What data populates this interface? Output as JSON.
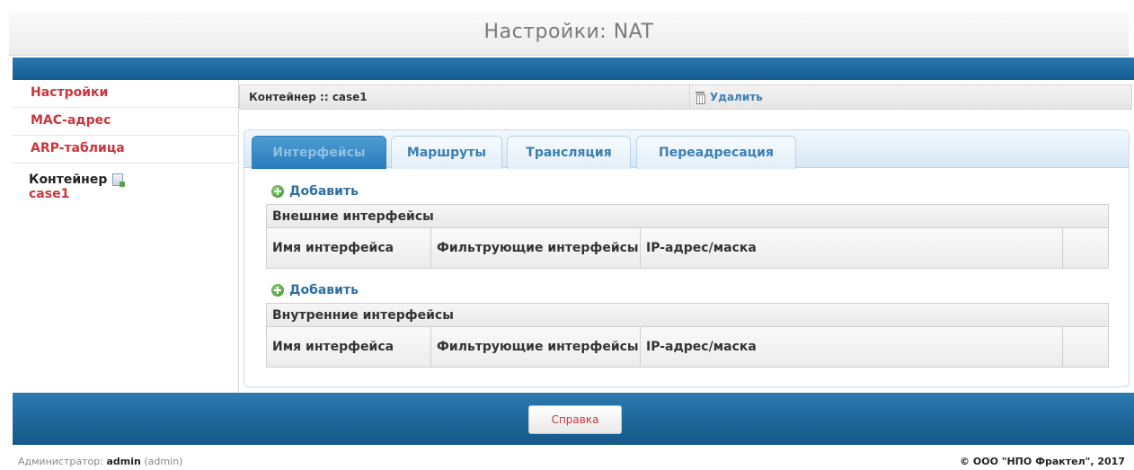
{
  "page": {
    "title": "Настройки: NAT"
  },
  "sidebar": {
    "items": [
      {
        "label": "Настройки"
      },
      {
        "label": "МАС-адрес"
      },
      {
        "label": "ARP-таблица"
      }
    ],
    "container_label": "Контейнер",
    "container_name": "case1"
  },
  "header": {
    "title": "Контейнер :: case1",
    "delete_label": "Удалить"
  },
  "tabs": [
    {
      "label": "Интерфейсы",
      "active": true
    },
    {
      "label": "Маршруты",
      "active": false
    },
    {
      "label": "Трансляция",
      "active": false
    },
    {
      "label": "Переадресация",
      "active": false
    }
  ],
  "sections": [
    {
      "add_label": "Добавить",
      "title": "Внешние интерфейсы",
      "columns": [
        "Имя интерфейса",
        "Фильтрующие интерфейсы",
        "IP-адрес/маска",
        ""
      ]
    },
    {
      "add_label": "Добавить",
      "title": "Внутренние интерфейсы",
      "columns": [
        "Имя интерфейса",
        "Фильтрующие интерфейсы",
        "IP-адрес/маска",
        ""
      ]
    }
  ],
  "footer": {
    "help_label": "Справка",
    "admin_prefix": "Администратор:",
    "admin_name": "admin",
    "admin_role": "(admin)",
    "copyright": "© ООО \"НПО Фрактел\", 2017"
  },
  "colors": {
    "accent_red": "#c9373d",
    "link_blue": "#2f6fa3",
    "band_blue": "#1d6aa1"
  },
  "icons": [
    "trash-icon",
    "plus-icon",
    "container-icon"
  ]
}
